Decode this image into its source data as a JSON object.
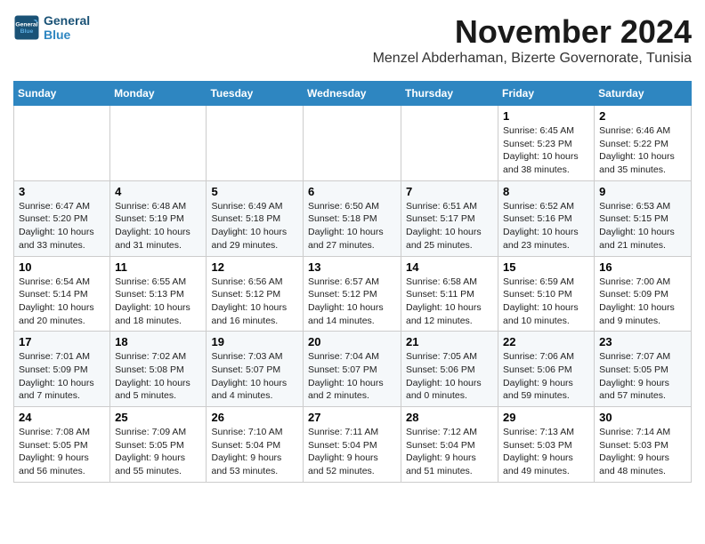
{
  "header": {
    "logo_line1": "General",
    "logo_line2": "Blue",
    "month_title": "November 2024",
    "subtitle": "Menzel Abderhaman, Bizerte Governorate, Tunisia"
  },
  "days_of_week": [
    "Sunday",
    "Monday",
    "Tuesday",
    "Wednesday",
    "Thursday",
    "Friday",
    "Saturday"
  ],
  "weeks": [
    {
      "days": [
        {
          "number": "",
          "info": ""
        },
        {
          "number": "",
          "info": ""
        },
        {
          "number": "",
          "info": ""
        },
        {
          "number": "",
          "info": ""
        },
        {
          "number": "",
          "info": ""
        },
        {
          "number": "1",
          "info": "Sunrise: 6:45 AM\nSunset: 5:23 PM\nDaylight: 10 hours and 38 minutes."
        },
        {
          "number": "2",
          "info": "Sunrise: 6:46 AM\nSunset: 5:22 PM\nDaylight: 10 hours and 35 minutes."
        }
      ]
    },
    {
      "days": [
        {
          "number": "3",
          "info": "Sunrise: 6:47 AM\nSunset: 5:20 PM\nDaylight: 10 hours and 33 minutes."
        },
        {
          "number": "4",
          "info": "Sunrise: 6:48 AM\nSunset: 5:19 PM\nDaylight: 10 hours and 31 minutes."
        },
        {
          "number": "5",
          "info": "Sunrise: 6:49 AM\nSunset: 5:18 PM\nDaylight: 10 hours and 29 minutes."
        },
        {
          "number": "6",
          "info": "Sunrise: 6:50 AM\nSunset: 5:18 PM\nDaylight: 10 hours and 27 minutes."
        },
        {
          "number": "7",
          "info": "Sunrise: 6:51 AM\nSunset: 5:17 PM\nDaylight: 10 hours and 25 minutes."
        },
        {
          "number": "8",
          "info": "Sunrise: 6:52 AM\nSunset: 5:16 PM\nDaylight: 10 hours and 23 minutes."
        },
        {
          "number": "9",
          "info": "Sunrise: 6:53 AM\nSunset: 5:15 PM\nDaylight: 10 hours and 21 minutes."
        }
      ]
    },
    {
      "days": [
        {
          "number": "10",
          "info": "Sunrise: 6:54 AM\nSunset: 5:14 PM\nDaylight: 10 hours and 20 minutes."
        },
        {
          "number": "11",
          "info": "Sunrise: 6:55 AM\nSunset: 5:13 PM\nDaylight: 10 hours and 18 minutes."
        },
        {
          "number": "12",
          "info": "Sunrise: 6:56 AM\nSunset: 5:12 PM\nDaylight: 10 hours and 16 minutes."
        },
        {
          "number": "13",
          "info": "Sunrise: 6:57 AM\nSunset: 5:12 PM\nDaylight: 10 hours and 14 minutes."
        },
        {
          "number": "14",
          "info": "Sunrise: 6:58 AM\nSunset: 5:11 PM\nDaylight: 10 hours and 12 minutes."
        },
        {
          "number": "15",
          "info": "Sunrise: 6:59 AM\nSunset: 5:10 PM\nDaylight: 10 hours and 10 minutes."
        },
        {
          "number": "16",
          "info": "Sunrise: 7:00 AM\nSunset: 5:09 PM\nDaylight: 10 hours and 9 minutes."
        }
      ]
    },
    {
      "days": [
        {
          "number": "17",
          "info": "Sunrise: 7:01 AM\nSunset: 5:09 PM\nDaylight: 10 hours and 7 minutes."
        },
        {
          "number": "18",
          "info": "Sunrise: 7:02 AM\nSunset: 5:08 PM\nDaylight: 10 hours and 5 minutes."
        },
        {
          "number": "19",
          "info": "Sunrise: 7:03 AM\nSunset: 5:07 PM\nDaylight: 10 hours and 4 minutes."
        },
        {
          "number": "20",
          "info": "Sunrise: 7:04 AM\nSunset: 5:07 PM\nDaylight: 10 hours and 2 minutes."
        },
        {
          "number": "21",
          "info": "Sunrise: 7:05 AM\nSunset: 5:06 PM\nDaylight: 10 hours and 0 minutes."
        },
        {
          "number": "22",
          "info": "Sunrise: 7:06 AM\nSunset: 5:06 PM\nDaylight: 9 hours and 59 minutes."
        },
        {
          "number": "23",
          "info": "Sunrise: 7:07 AM\nSunset: 5:05 PM\nDaylight: 9 hours and 57 minutes."
        }
      ]
    },
    {
      "days": [
        {
          "number": "24",
          "info": "Sunrise: 7:08 AM\nSunset: 5:05 PM\nDaylight: 9 hours and 56 minutes."
        },
        {
          "number": "25",
          "info": "Sunrise: 7:09 AM\nSunset: 5:05 PM\nDaylight: 9 hours and 55 minutes."
        },
        {
          "number": "26",
          "info": "Sunrise: 7:10 AM\nSunset: 5:04 PM\nDaylight: 9 hours and 53 minutes."
        },
        {
          "number": "27",
          "info": "Sunrise: 7:11 AM\nSunset: 5:04 PM\nDaylight: 9 hours and 52 minutes."
        },
        {
          "number": "28",
          "info": "Sunrise: 7:12 AM\nSunset: 5:04 PM\nDaylight: 9 hours and 51 minutes."
        },
        {
          "number": "29",
          "info": "Sunrise: 7:13 AM\nSunset: 5:03 PM\nDaylight: 9 hours and 49 minutes."
        },
        {
          "number": "30",
          "info": "Sunrise: 7:14 AM\nSunset: 5:03 PM\nDaylight: 9 hours and 48 minutes."
        }
      ]
    }
  ]
}
